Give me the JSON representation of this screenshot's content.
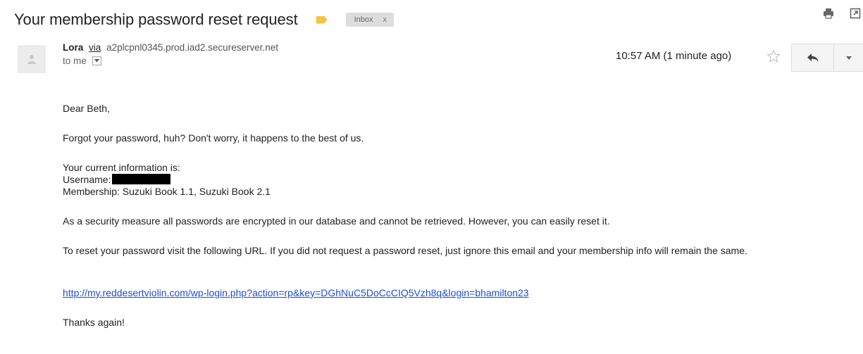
{
  "subject": "Your membership password reset request",
  "label": {
    "text": "Inbox",
    "remove": "x"
  },
  "toolbar": {
    "print_icon": "print-icon",
    "newwindow_icon": "new-window-icon"
  },
  "message": {
    "sender_name": "Lora",
    "via": "via",
    "sender_domain": "a2plcpnl0345.prod.iad2.secureserver.net",
    "to": "to me",
    "timestamp": "10:57 AM (1 minute ago)",
    "icons": {
      "star": "star-icon",
      "reply": "reply-icon",
      "more": "chevron-down-icon",
      "avatar": "person-icon"
    }
  },
  "body": {
    "greeting": "Dear Beth,",
    "line1": "Forgot your password, huh? Don't worry, it happens to the best of us.",
    "info_heading": "Your current information is:",
    "username_label": "Username:",
    "membership": "Membership: Suzuki Book 1.1, Suzuki Book 2.1",
    "security": "As a security measure all passwords are encrypted in our database and cannot be retrieved. However, you can easily reset it.",
    "instructions": "To reset your password visit the following URL. If you did not request a password reset, just ignore this email and your membership info will remain the same.",
    "link": "http://my.reddesertviolin.com/wp-login.php?action=rp&key=DGhNuC5DoCcCIQ5Vzh8q&login=bhamilton23",
    "thanks": "Thanks again!"
  },
  "colors": {
    "link": "#1a4fd6",
    "importance": "#f4c542",
    "label_bg": "#dddddd"
  }
}
